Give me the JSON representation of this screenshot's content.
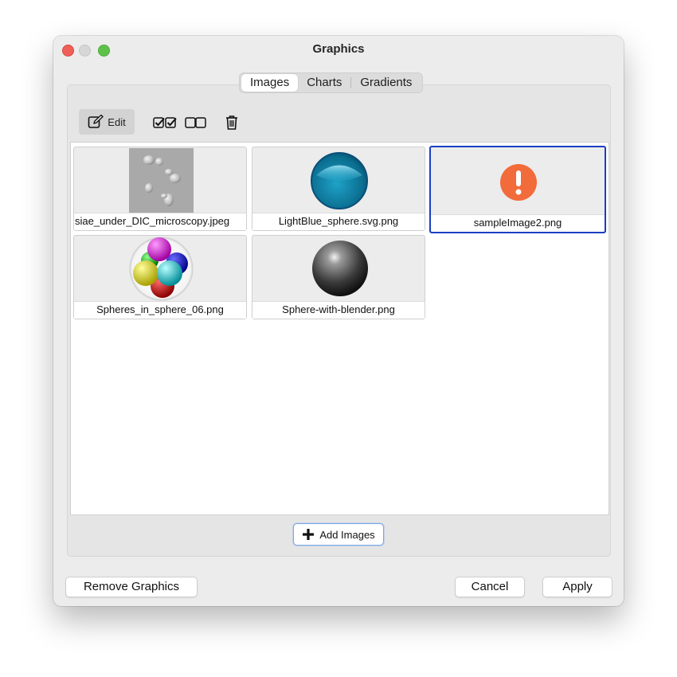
{
  "window": {
    "title": "Graphics"
  },
  "tabs": [
    {
      "label": "Images",
      "active": true
    },
    {
      "label": "Charts",
      "active": false
    },
    {
      "label": "Gradients",
      "active": false
    }
  ],
  "toolbar": {
    "edit_label": "Edit",
    "select_all_icon": "check-all-icon",
    "select_none_icon": "uncheck-all-icon",
    "delete_icon": "trash-icon"
  },
  "images": [
    {
      "caption": "Saccharomyces_cerevisiae_under_DIC_microscopy.jpeg",
      "shown": "siae_under_DIC_microscopy.jpeg",
      "thumb": "microscopy-photo",
      "selected": false
    },
    {
      "caption": "LightBlue_sphere.svg.png",
      "thumb": "blue-sphere",
      "selected": false
    },
    {
      "caption": "sampleImage2.png",
      "thumb": "warning-icon",
      "selected": true
    },
    {
      "caption": "Spheres_in_sphere_06.png",
      "thumb": "colored-spheres",
      "selected": false
    },
    {
      "caption": "Sphere-with-blender.png",
      "thumb": "gray-sphere",
      "selected": false
    }
  ],
  "add_images_label": "Add Images",
  "buttons": {
    "remove": "Remove Graphics",
    "cancel": "Cancel",
    "apply": "Apply"
  },
  "colors": {
    "selection_border": "#1a3ec2",
    "warning_orange": "#f26b3a"
  }
}
